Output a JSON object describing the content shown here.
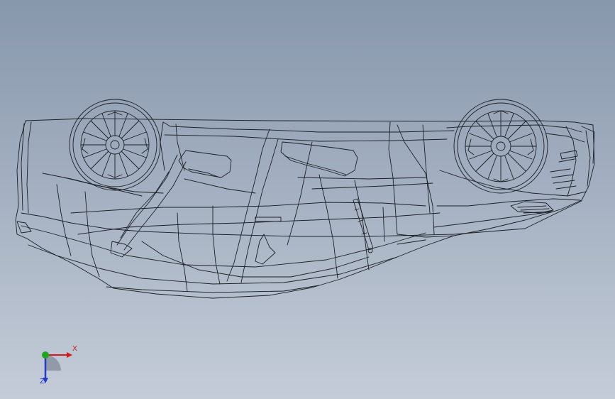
{
  "viewport": {
    "background_top": "#8797ac",
    "background_bottom": "#c4ccd8"
  },
  "model": {
    "edge_color": "#1b1f26"
  },
  "triad": {
    "x_label": "X",
    "z_label": "Z",
    "x_color": "#d21a1a",
    "y_color": "#1fa61f",
    "z_color": "#2a38c8"
  }
}
